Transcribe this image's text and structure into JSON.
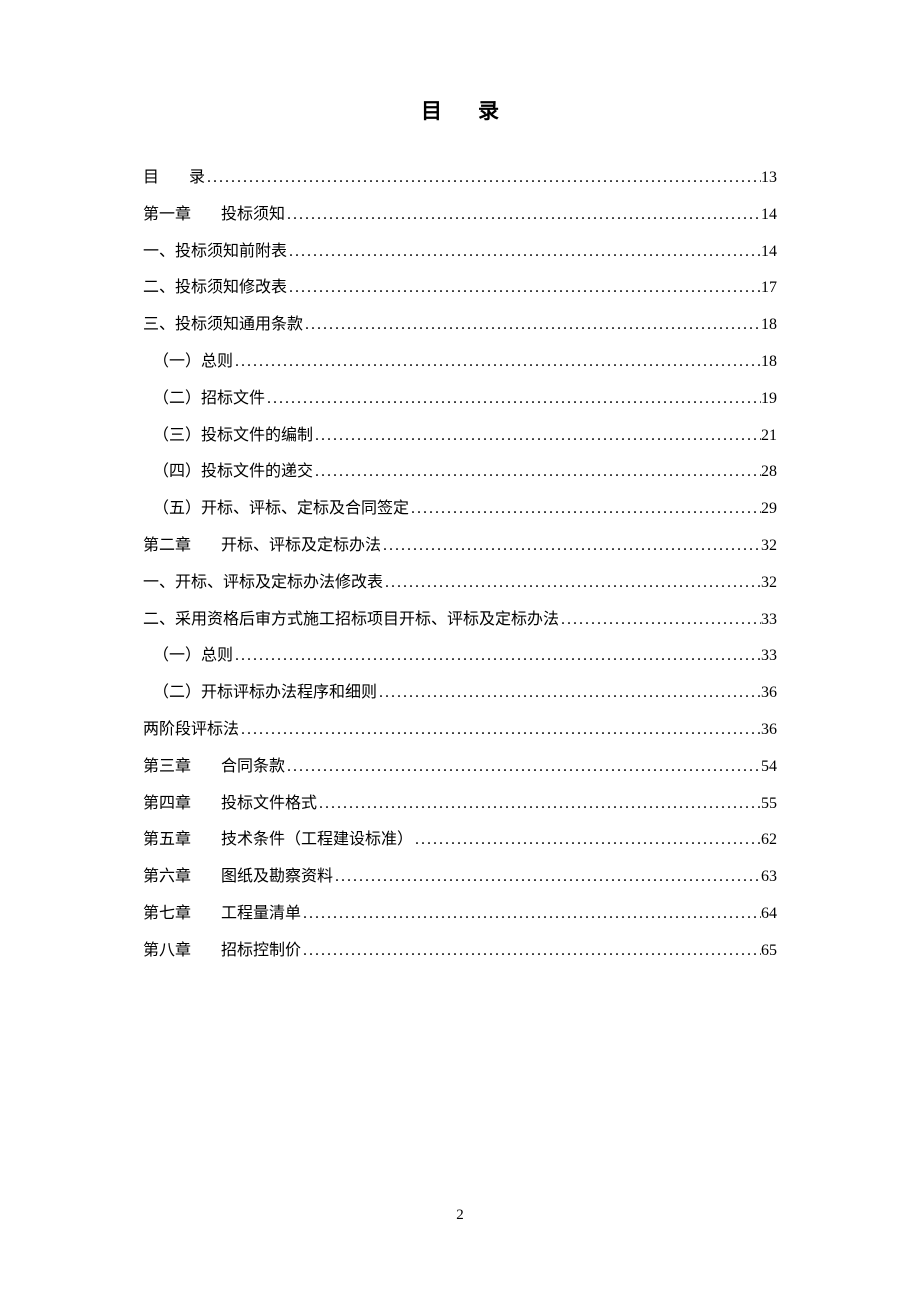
{
  "title": "目录",
  "page_number": "2",
  "toc": [
    {
      "label_parts": [
        "目",
        "录"
      ],
      "page": "13",
      "gap": true,
      "level": 1
    },
    {
      "label_parts": [
        "第一章",
        "投标须知"
      ],
      "page": "14",
      "gap": true,
      "level": 1
    },
    {
      "label_parts": [
        "一、投标须知前附表"
      ],
      "page": "14",
      "level": 1
    },
    {
      "label_parts": [
        "二、投标须知修改表"
      ],
      "page": "17",
      "level": 1
    },
    {
      "label_parts": [
        "三、投标须知通用条款"
      ],
      "page": "18",
      "level": 1
    },
    {
      "label_parts": [
        "（一）总则"
      ],
      "page": "18",
      "level": 2
    },
    {
      "label_parts": [
        "（二）招标文件"
      ],
      "page": "19",
      "level": 2
    },
    {
      "label_parts": [
        "（三）投标文件的编制"
      ],
      "page": "21",
      "level": 2
    },
    {
      "label_parts": [
        "（四）投标文件的递交"
      ],
      "page": "28",
      "level": 2
    },
    {
      "label_parts": [
        "（五）开标、评标、定标及合同签定"
      ],
      "page": "29",
      "level": 2
    },
    {
      "label_parts": [
        "第二章",
        "开标、评标及定标办法"
      ],
      "page": "32",
      "gap": true,
      "level": 1
    },
    {
      "label_parts": [
        "一、开标、评标及定标办法修改表"
      ],
      "page": "32",
      "level": 1
    },
    {
      "label_parts": [
        "二、采用资格后审方式施工招标项目开标、评标及定标办法"
      ],
      "page": "33",
      "level": 1
    },
    {
      "label_parts": [
        "（一）总则"
      ],
      "page": "33",
      "level": 2
    },
    {
      "label_parts": [
        "（二）开标评标办法程序和细则"
      ],
      "page": "36",
      "level": 2
    },
    {
      "label_parts": [
        "两阶段评标法"
      ],
      "page": "36",
      "level": 1
    },
    {
      "label_parts": [
        "第三章",
        "合同条款"
      ],
      "page": "54",
      "gap": true,
      "level": 1
    },
    {
      "label_parts": [
        "第四章",
        "投标文件格式"
      ],
      "page": "55",
      "gap_wide": true,
      "level": 1
    },
    {
      "label_parts": [
        "第五章",
        "技术条件（工程建设标准）"
      ],
      "page": "62",
      "gap": true,
      "level": 1
    },
    {
      "label_parts": [
        "第六章",
        "图纸及勘察资料"
      ],
      "page": "63",
      "gap": true,
      "level": 1
    },
    {
      "label_parts": [
        "第七章",
        "工程量清单"
      ],
      "page": "64",
      "gap": true,
      "level": 1
    },
    {
      "label_parts": [
        "第八章",
        "招标控制价"
      ],
      "page": "65",
      "gap": true,
      "level": 1
    }
  ]
}
